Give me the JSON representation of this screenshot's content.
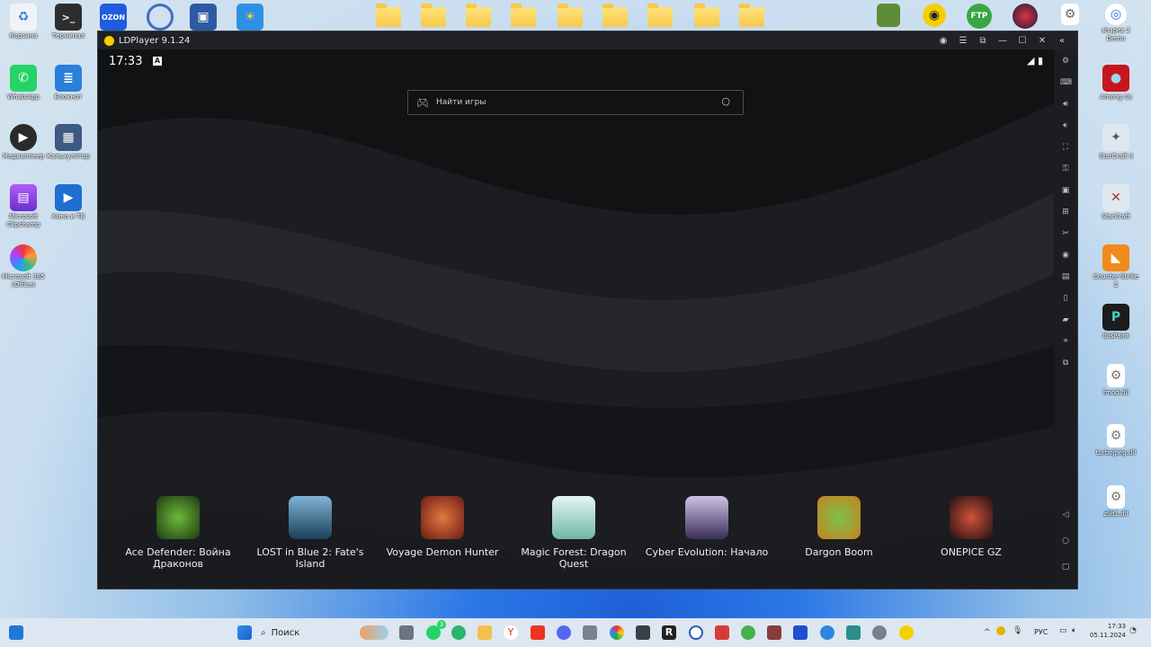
{
  "desktop": {
    "left_icons": [
      {
        "label": "Корзина",
        "icon": "recycle-bin-icon"
      },
      {
        "label": "Терминал",
        "icon": "terminal-icon"
      },
      {
        "label": "WhatsApp",
        "icon": "whatsapp-icon"
      },
      {
        "label": "Блокнот",
        "icon": "notepad-icon"
      },
      {
        "label": "Медиаплеер",
        "icon": "media-player-icon"
      },
      {
        "label": "Калькулятор",
        "icon": "calculator-icon"
      },
      {
        "label": "Microsoft Clipchamp",
        "icon": "clipchamp-icon"
      },
      {
        "label": "Кино и ТВ",
        "icon": "movies-tv-icon"
      },
      {
        "label": "Microsoft 365 (Office)",
        "icon": "office-icon"
      }
    ],
    "top_icons": [
      {
        "label": "OZON",
        "icon": "ozon-icon"
      },
      {
        "label": "FTP",
        "icon": "ftp-icon"
      }
    ],
    "right_icons": [
      {
        "label": "shapez 2 Demo",
        "icon": "shapez-icon"
      },
      {
        "label": "Among Us",
        "icon": "among-us-icon"
      },
      {
        "label": "StarCraft II",
        "icon": "starcraft2-icon"
      },
      {
        "label": "StarCraft",
        "icon": "starcraft-icon"
      },
      {
        "label": "Counter-Strike 2",
        "icon": "cs2-icon"
      },
      {
        "label": "ibisPaint",
        "icon": "ibispaint-icon"
      },
      {
        "label": "fmod.dll",
        "icon": "dll-file-icon"
      },
      {
        "label": "turbojpeg.dll",
        "icon": "dll-file-icon"
      },
      {
        "label": "zlib1.dll",
        "icon": "dll-file-icon"
      }
    ]
  },
  "window": {
    "title": "LDPlayer 9.1.24"
  },
  "status_bar": {
    "time": "17:33"
  },
  "search": {
    "placeholder": "Найти игры"
  },
  "apps": [
    {
      "name": "Ace Defender: Война Драконов",
      "color": "#3c7a2a"
    },
    {
      "name": "LOST in Blue 2: Fate's Island",
      "color": "#2a5c78"
    },
    {
      "name": "Voyage Demon Hunter",
      "color": "#b6402c"
    },
    {
      "name": "Magic Forest: Dragon Quest",
      "color": "#a9d3d0"
    },
    {
      "name": "Cyber Evolution: Начало",
      "color": "#8a7aa8"
    },
    {
      "name": "Dargon Boom",
      "color": "#d99a2a"
    },
    {
      "name": "ONEPICE GZ",
      "color": "#8a2a22"
    }
  ],
  "taskbar": {
    "search_label": "Поиск",
    "language": "РУС",
    "time": "17:33",
    "date": "05.11.2024",
    "whatsapp_badge": "3"
  }
}
